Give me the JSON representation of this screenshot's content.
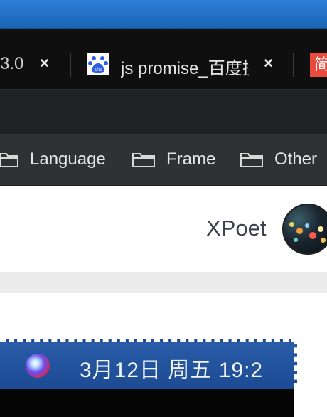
{
  "browser": {
    "tabs": [
      {
        "title": "3.0",
        "close": "×"
      },
      {
        "title": "js promise_百度搜",
        "close": "×"
      },
      {
        "title": "简",
        "close": ""
      }
    ],
    "bookmarks": [
      {
        "label": "Language",
        "icon": "folder-icon"
      },
      {
        "label": "Frame",
        "icon": "folder-icon"
      },
      {
        "label": "Other",
        "icon": "folder-icon"
      }
    ]
  },
  "page": {
    "username": "XPoet"
  },
  "menubar": {
    "clock": "3月12日 周五  19:2"
  },
  "colors": {
    "tab_strip": "#0f0f10",
    "toolbar": "#202124",
    "bookmarks_bar": "#303134",
    "username_text": "#3a4150",
    "menubar_blue": "#1c4b93"
  }
}
